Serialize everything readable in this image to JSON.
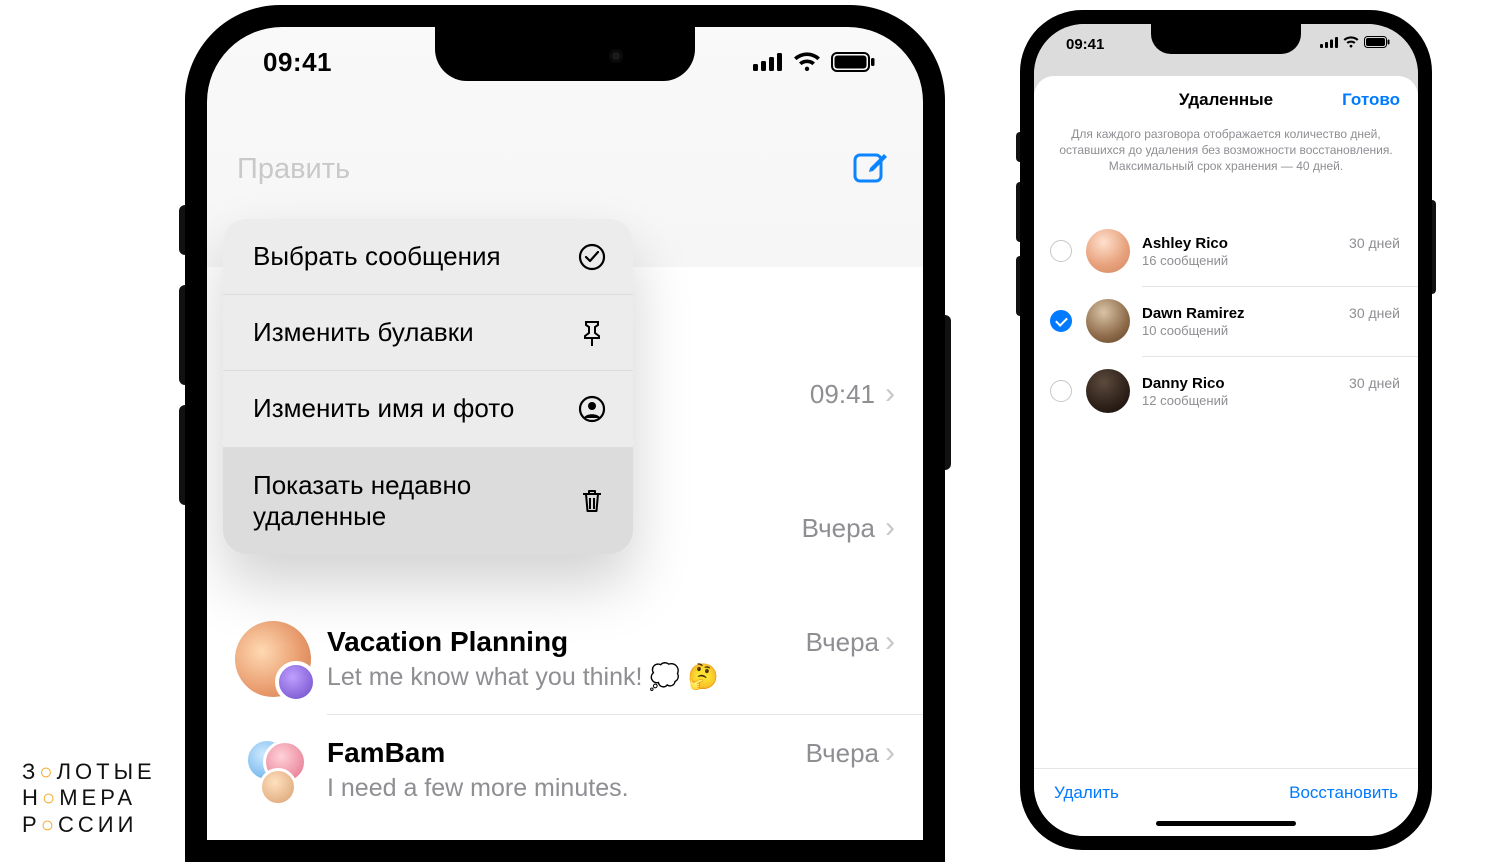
{
  "statusbar": {
    "time": "09:41"
  },
  "leftPhone": {
    "edit": "Править",
    "menu": {
      "select": "Выбрать сообщения",
      "pins": "Изменить булавки",
      "nameAndPhoto": "Изменить имя и фото",
      "showDeleted": "Показать недавно удаленные"
    },
    "peek1_time": "09:41",
    "peek2_time": "Вчера",
    "chats": [
      {
        "name": "Vacation Planning",
        "time": "Вчера",
        "preview": "Let me know what you think! 💭 🤔"
      },
      {
        "name": "FamBam",
        "time": "Вчера",
        "preview": "I need a few more minutes."
      }
    ]
  },
  "rightPhone": {
    "title": "Удаленные",
    "done": "Готово",
    "description": "Для каждого разговора отображается количество дней, оставшихся до удаления без возможности восстановления. Максимальный срок хранения — 40 дней.",
    "items": [
      {
        "name": "Ashley Rico",
        "sub": "16 сообщений",
        "days": "30 дней",
        "checked": false
      },
      {
        "name": "Dawn Ramirez",
        "sub": "10 сообщений",
        "days": "30 дней",
        "checked": true
      },
      {
        "name": "Danny Rico",
        "sub": "12 сообщений",
        "days": "30 дней",
        "checked": false
      }
    ],
    "toolbar": {
      "delete": "Удалить",
      "recover": "Восстановить"
    }
  },
  "logo": {
    "l1a": "З",
    "l1b": "ЛОТЫЕ",
    "l2a": "Н",
    "l2b": "МЕРА",
    "l3a": "Р",
    "l3b": "ССИИ"
  }
}
